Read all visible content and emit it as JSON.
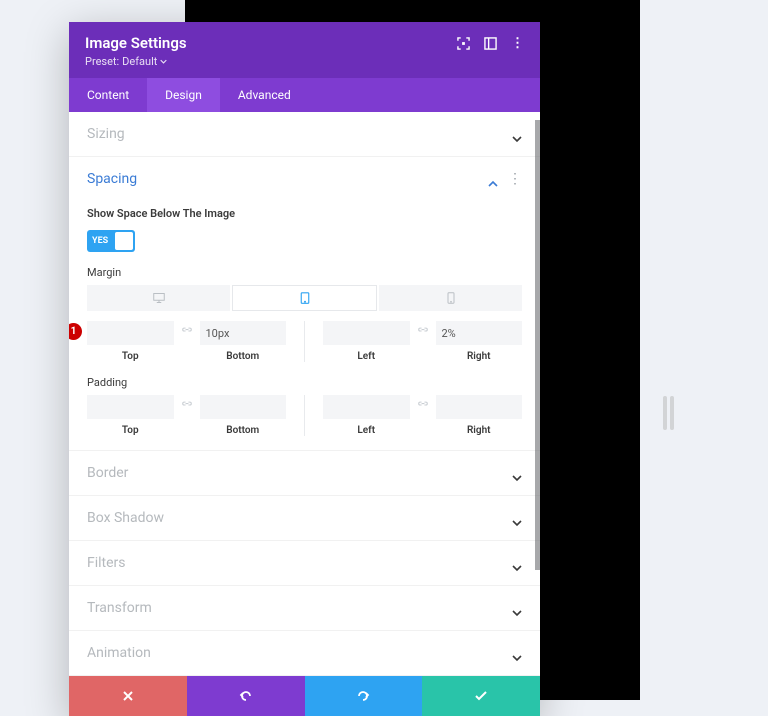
{
  "header": {
    "title": "Image Settings",
    "preset_label": "Preset:",
    "preset_value": "Default"
  },
  "tabs": {
    "content": "Content",
    "design": "Design",
    "advanced": "Advanced"
  },
  "sections": {
    "sizing": "Sizing",
    "spacing": "Spacing",
    "border": "Border",
    "box_shadow": "Box Shadow",
    "filters": "Filters",
    "transform": "Transform",
    "animation": "Animation"
  },
  "spacing": {
    "show_space_label": "Show Space Below The Image",
    "toggle_value": "YES",
    "margin_label": "Margin",
    "padding_label": "Padding",
    "top": "Top",
    "bottom": "Bottom",
    "left": "Left",
    "right": "Right",
    "margin_bottom_value": "10px",
    "margin_right_value": "2%"
  },
  "badge": "1"
}
